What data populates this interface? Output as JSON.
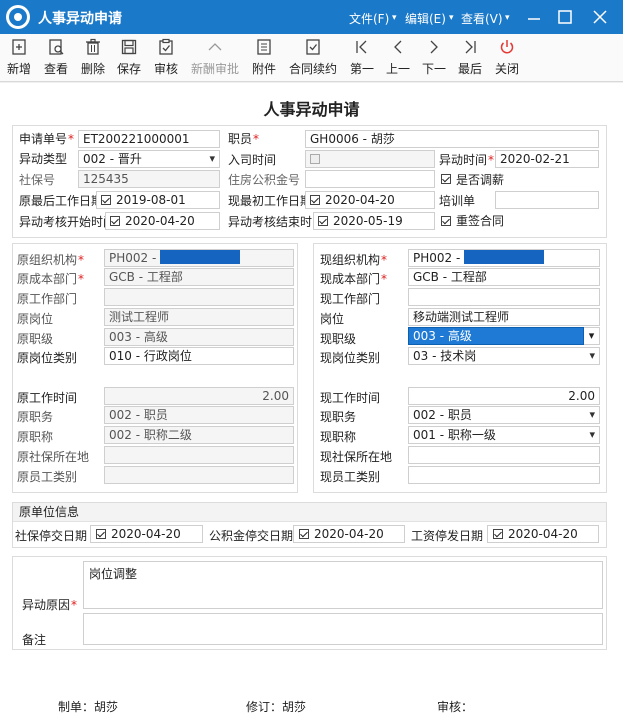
{
  "window": {
    "title": "人事异动申请",
    "menus": [
      "文件(F)",
      "编辑(E)",
      "查看(V)"
    ]
  },
  "toolbar": [
    {
      "name": "add",
      "label": "新增",
      "icon": "new-file-icon",
      "enabled": true
    },
    {
      "name": "view",
      "label": "查看",
      "icon": "view-icon",
      "enabled": true
    },
    {
      "name": "delete",
      "label": "删除",
      "icon": "trash-icon",
      "enabled": true
    },
    {
      "name": "save",
      "label": "保存",
      "icon": "save-icon",
      "enabled": true
    },
    {
      "name": "audit",
      "label": "审核",
      "icon": "audit-icon",
      "enabled": true
    },
    {
      "name": "salary-approve",
      "label": "新酬审批",
      "icon": "chevron-up-icon",
      "enabled": false
    },
    {
      "name": "attachment",
      "label": "附件",
      "icon": "attachment-icon",
      "enabled": true
    },
    {
      "name": "contract-renew",
      "label": "合同续约",
      "icon": "contract-icon",
      "enabled": true
    },
    {
      "name": "first",
      "label": "第一",
      "icon": "first-icon",
      "enabled": true
    },
    {
      "name": "prev",
      "label": "上一",
      "icon": "prev-icon",
      "enabled": true
    },
    {
      "name": "next",
      "label": "下一",
      "icon": "next-icon",
      "enabled": true
    },
    {
      "name": "last",
      "label": "最后",
      "icon": "last-icon",
      "enabled": true
    },
    {
      "name": "close",
      "label": "关闭",
      "icon": "power-icon",
      "enabled": true
    }
  ],
  "form": {
    "title": "人事异动申请",
    "header": {
      "apply_no_label": "申请单号",
      "apply_no": "ET200221000001",
      "employee_label": "职员",
      "employee": "GH0006 - 胡莎",
      "change_type_label": "异动类型",
      "change_type": "002 - 晋升",
      "entry_date_label": "入司时间",
      "change_date_label": "异动时间",
      "change_date": "2020-02-21",
      "social_no_label": "社保号",
      "social_no": "125435",
      "housing_fund_label": "住房公积金号",
      "adjust_salary_label": "是否调薪",
      "orig_last_work_label": "原最后工作日期",
      "orig_last_work": "2019-08-01",
      "new_first_work_label": "现最初工作日期",
      "new_first_work": "2020-04-20",
      "training_label": "培训单",
      "assess_start_label": "异动考核开始时间",
      "assess_start": "2020-04-20",
      "assess_end_label": "异动考核结束时间",
      "assess_end": "2020-05-19",
      "resign_contract_label": "重签合同"
    },
    "orig": {
      "org_label": "原组织机构",
      "org": "PH002 -",
      "cost_dept_label": "原成本部门",
      "cost_dept": "GCB - 工程部",
      "work_dept_label": "原工作部门",
      "position_label": "原岗位",
      "position": "测试工程师",
      "grade_label": "原职级",
      "grade": "003 - 高级",
      "pos_type_label": "原岗位类别",
      "pos_type": "010 - 行政岗位",
      "work_time_label": "原工作时间",
      "work_time": "2.00",
      "duty_label": "原职务",
      "duty": "002 - 职员",
      "title_label": "原职称",
      "title": "002 - 职称二级",
      "social_loc_label": "原社保所在地",
      "emp_type_label": "原员工类别"
    },
    "curr": {
      "org_label": "现组织机构",
      "org": "PH002 -",
      "cost_dept_label": "现成本部门",
      "cost_dept": "GCB - 工程部",
      "work_dept_label": "现工作部门",
      "position_label": "岗位",
      "position": "移动端测试工程师",
      "grade_label": "现职级",
      "grade": "003 - 高级",
      "pos_type_label": "现岗位类别",
      "pos_type": "03 - 技术岗",
      "work_time_label": "现工作时间",
      "work_time": "2.00",
      "duty_label": "现职务",
      "duty": "002 - 职员",
      "title_label": "现职称",
      "title": "001 - 职称一级",
      "social_loc_label": "现社保所在地",
      "emp_type_label": "现员工类别"
    },
    "orig_unit": {
      "section_title": "原单位信息",
      "social_stop_label": "社保停交日期",
      "social_stop": "2020-04-20",
      "fund_stop_label": "公积金停交日期",
      "fund_stop": "2020-04-20",
      "salary_stop_label": "工资停发日期",
      "salary_stop": "2020-04-20"
    },
    "reason": {
      "label": "异动原因",
      "value": "岗位调整",
      "remark_label": "备注"
    },
    "footer": {
      "maker": "制单：胡莎",
      "modifier": "修订：胡莎",
      "auditor": "审核："
    }
  },
  "colors": {
    "titlebar": "#1b79c9",
    "required": "#e02020",
    "selection": "#1e7ad4"
  }
}
